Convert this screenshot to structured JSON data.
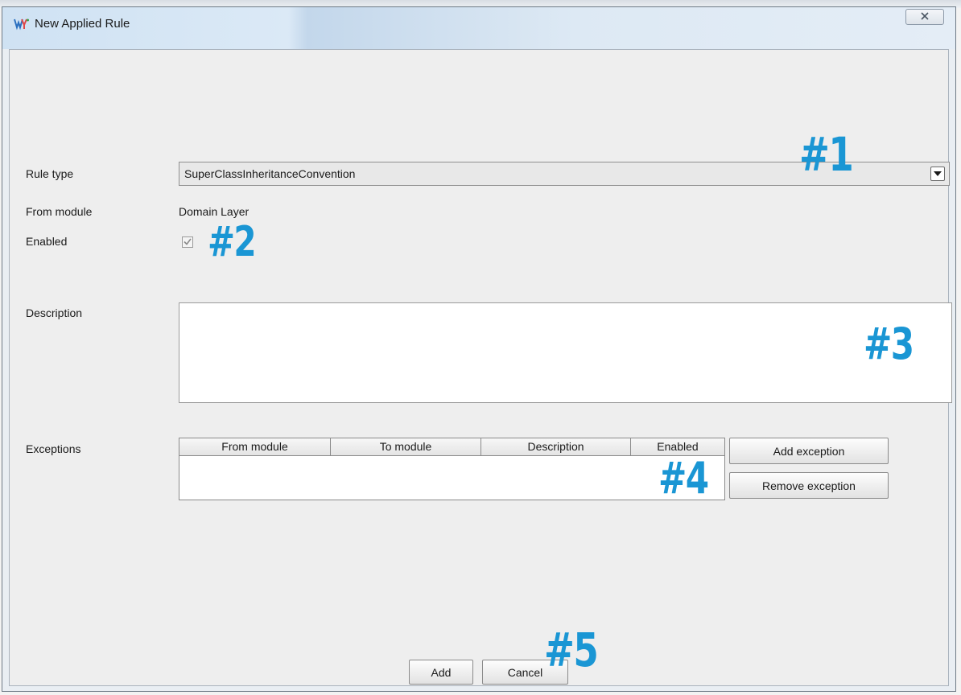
{
  "window": {
    "title": "New Applied Rule",
    "close_label": "×"
  },
  "form": {
    "rule_type_label": "Rule type",
    "rule_type_value": "SuperClassInheritanceConvention",
    "from_module_label": "From module",
    "from_module_value": "Domain Layer",
    "enabled_label": "Enabled",
    "enabled_checked": true,
    "description_label": "Description",
    "description_value": "",
    "exceptions_label": "Exceptions"
  },
  "exceptions_table": {
    "columns": [
      "From module",
      "To module",
      "Description",
      "Enabled"
    ],
    "rows": []
  },
  "buttons": {
    "add_exception": "Add exception",
    "remove_exception": "Remove exception",
    "add": "Add",
    "cancel": "Cancel"
  },
  "markers": [
    "#1",
    "#2",
    "#3",
    "#4",
    "#5"
  ],
  "colors": {
    "marker": "#1a96d4",
    "dialog_bg": "#eeeeee",
    "titlebar": "#dbe9f6"
  }
}
